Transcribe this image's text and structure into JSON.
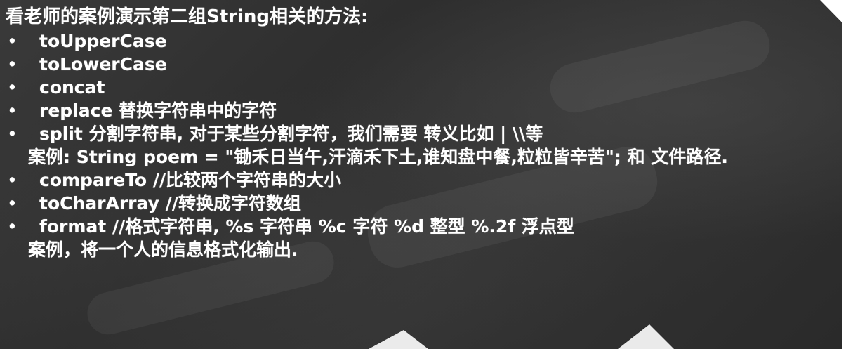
{
  "heading": "看老师的案例演示第二组String相关的方法:",
  "bullet_char": "•",
  "items": [
    {
      "text": "toUpperCase",
      "note": ""
    },
    {
      "text": "toLowerCase",
      "note": ""
    },
    {
      "text": "concat",
      "note": ""
    },
    {
      "text": "replace 替换字符串中的字符",
      "note": ""
    },
    {
      "text": "split 分割字符串, 对于某些分割字符，我们需要 转义比如 | \\\\等",
      "note": "案例: String poem = \"锄禾日当午,汗滴禾下土,谁知盘中餐,粒粒皆辛苦\"; 和 文件路径."
    },
    {
      "text": "compareTo //比较两个字符串的大小",
      "note": ""
    },
    {
      "text": "toCharArray //转换成字符数组",
      "note": ""
    },
    {
      "text": "format //格式字符串, %s 字符串 %c 字符 %d 整型 %.2f 浮点型",
      "note": "案例，将一个人的信息格式化输出."
    }
  ]
}
